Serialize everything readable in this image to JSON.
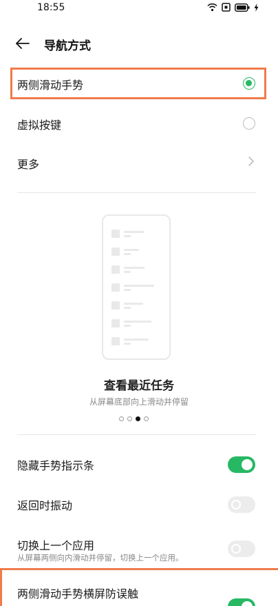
{
  "status_bar": {
    "time": "18:55",
    "icons": [
      "wifi-icon",
      "notification-icon",
      "battery-icon",
      "charging-icon"
    ]
  },
  "header": {
    "back_icon": "arrow-left-icon",
    "title": "导航方式"
  },
  "nav_options": [
    {
      "label": "两侧滑动手势",
      "selected": true
    },
    {
      "label": "虚拟按键",
      "selected": false
    }
  ],
  "more": {
    "label": "更多",
    "icon": "chevron-right-icon"
  },
  "illustration": {
    "title": "查看最近任务",
    "subtitle": "从屏幕底部向上滑动并停留",
    "page_count": 4,
    "active_page": 3
  },
  "settings": [
    {
      "label": "隐藏手势指示条",
      "description": "",
      "enabled": true
    },
    {
      "label": "返回时振动",
      "description": "",
      "enabled": false
    },
    {
      "label": "切换上一个应用",
      "description": "从屏幕两侧向内滑动并停留，切换上一个应用。",
      "enabled": false
    },
    {
      "label": "两侧滑动手势横屏防误触",
      "description": "",
      "enabled": true
    }
  ],
  "colors": {
    "accent_green": "#27b864",
    "highlight_orange": "#f07a4a",
    "toggle_off": "#ececec"
  }
}
